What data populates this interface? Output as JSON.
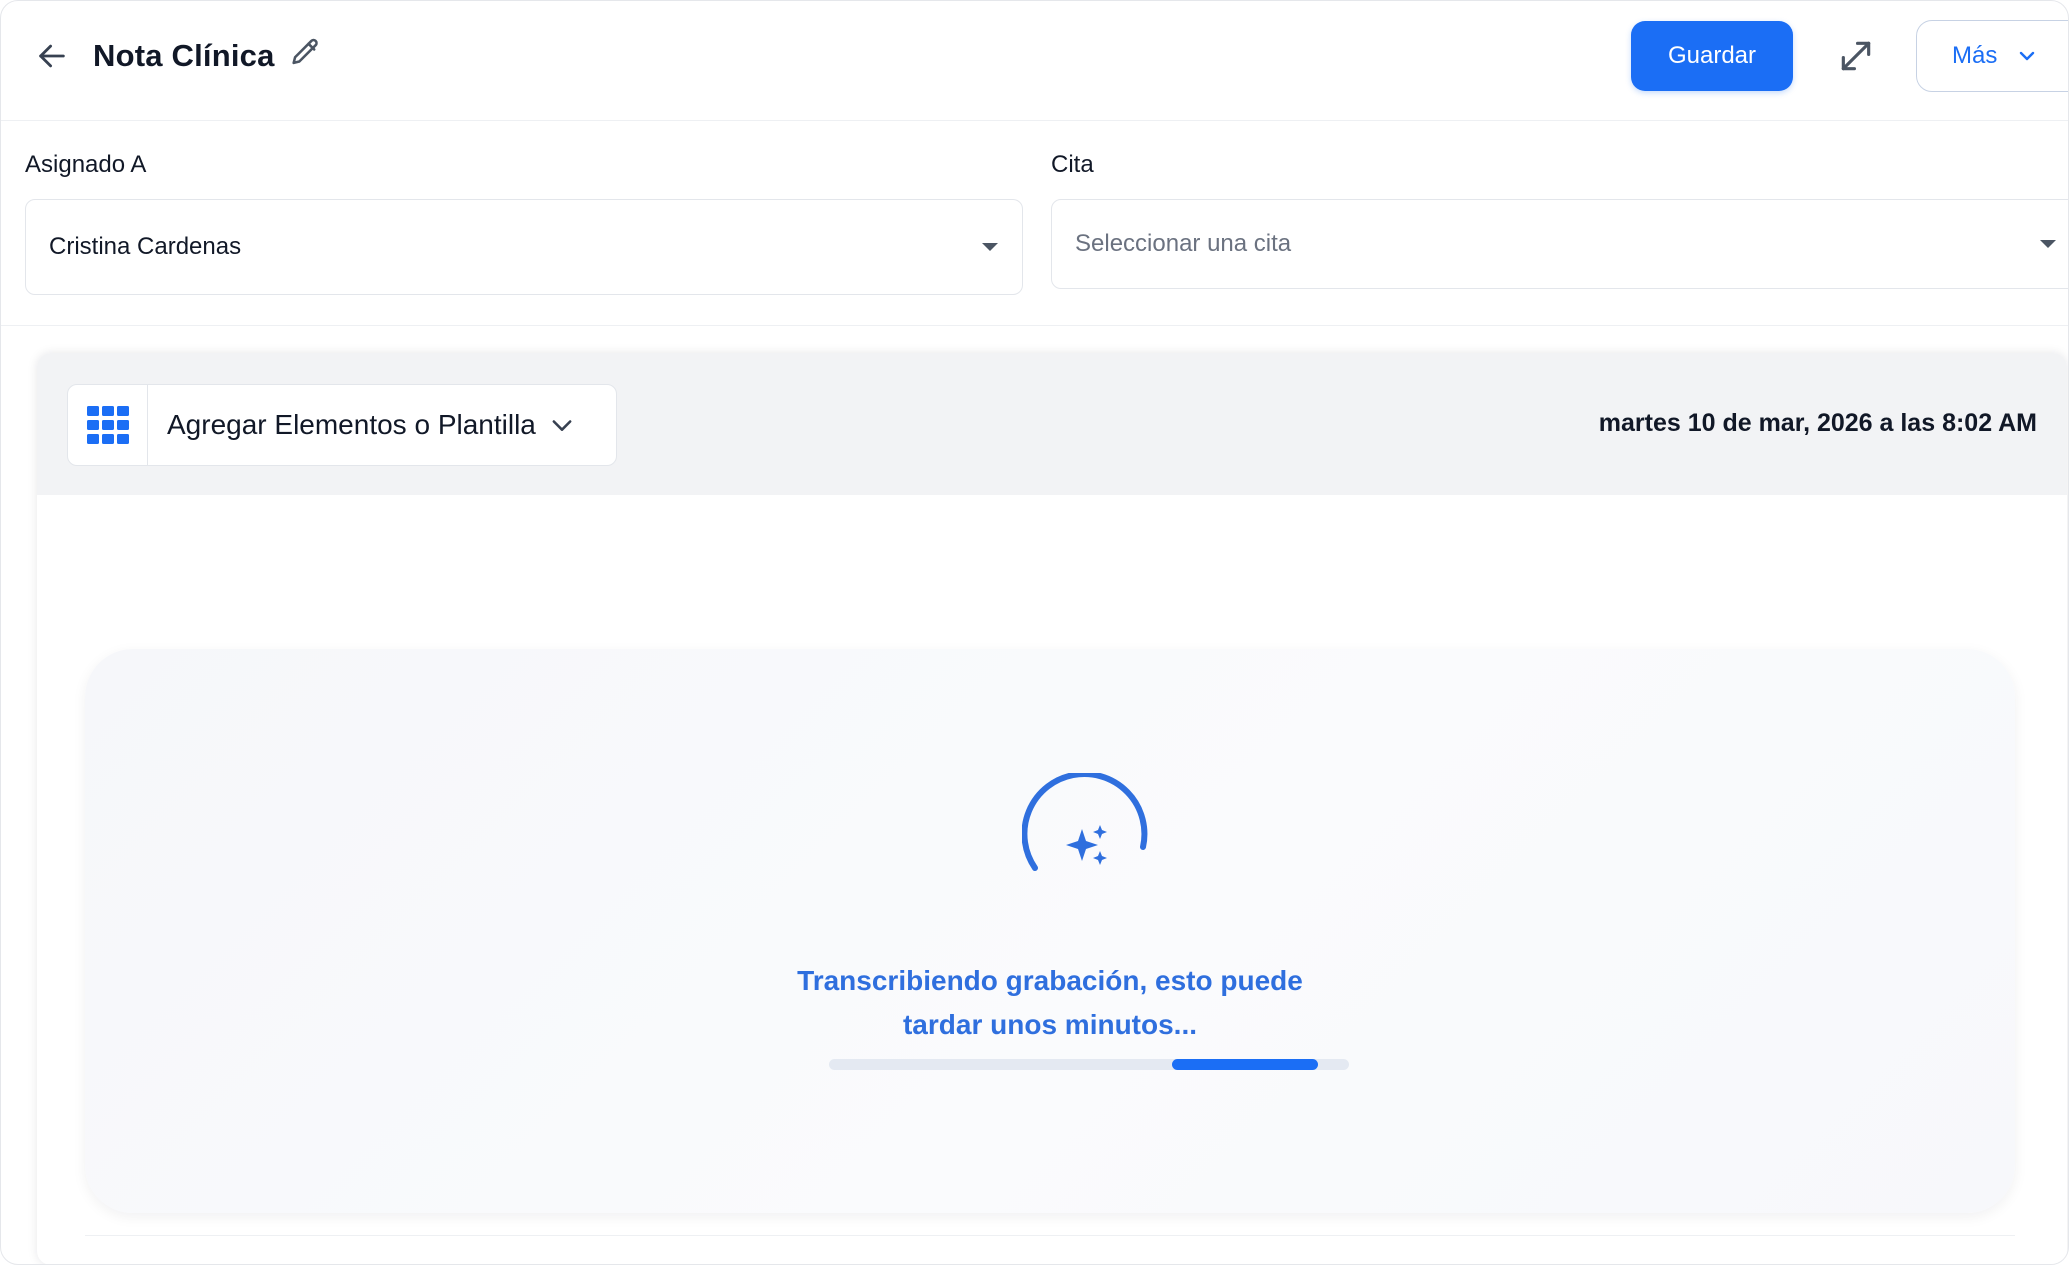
{
  "header": {
    "title": "Nota Clínica",
    "save_label": "Guardar",
    "more_label": "Más"
  },
  "fields": {
    "assigned": {
      "label": "Asignado A",
      "value": "Cristina Cardenas"
    },
    "appointment": {
      "label": "Cita",
      "placeholder": "Seleccionar una cita"
    }
  },
  "toolbar": {
    "template_label": "Agregar Elementos o Plantilla",
    "timestamp": "martes 10 de mar, 2026 a las 8:02 AM"
  },
  "transcription": {
    "status_line1": "Transcribiendo grabación, esto puede",
    "status_line2": "tardar unos minutos...",
    "progress_start": 0.66,
    "progress_end": 0.94
  },
  "colors": {
    "accent": "#1b6ef5",
    "status_text": "#2f6fde"
  },
  "icons": [
    "arrow-left-icon",
    "pencil-icon",
    "expand-icon",
    "chevron-down-icon",
    "grid-icon",
    "sparkles-icon"
  ]
}
